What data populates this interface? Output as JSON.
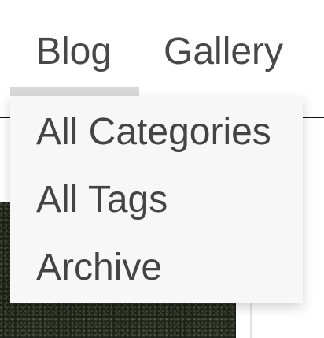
{
  "nav": {
    "items": [
      {
        "label": "Blog",
        "active": true
      },
      {
        "label": "Gallery",
        "active": false
      }
    ]
  },
  "dropdown": {
    "items": [
      {
        "label": "All Categories"
      },
      {
        "label": "All Tags"
      },
      {
        "label": "Archive"
      }
    ]
  },
  "colors": {
    "text": "#444444",
    "underline": "#d9d9d9",
    "dropdown_bg": "#f7f7f7",
    "divider": "#111111"
  }
}
